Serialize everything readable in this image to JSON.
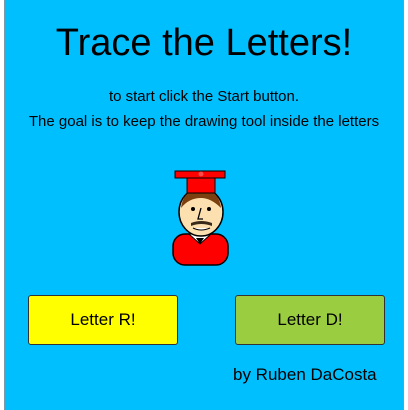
{
  "colors": {
    "background": "#00bfff",
    "letter_r_button": "#ffff00",
    "letter_d_button": "#9acd3f"
  },
  "title": "Trace the Letters!",
  "instructions": {
    "line1": "to start click the Start button.",
    "line2": "The goal is to keep the drawing tool inside the letters"
  },
  "avatar": {
    "icon": "graduate-character-icon"
  },
  "buttons": {
    "letter_r": "Letter R!",
    "letter_d": "Letter D!"
  },
  "credit": "by Ruben DaCosta"
}
